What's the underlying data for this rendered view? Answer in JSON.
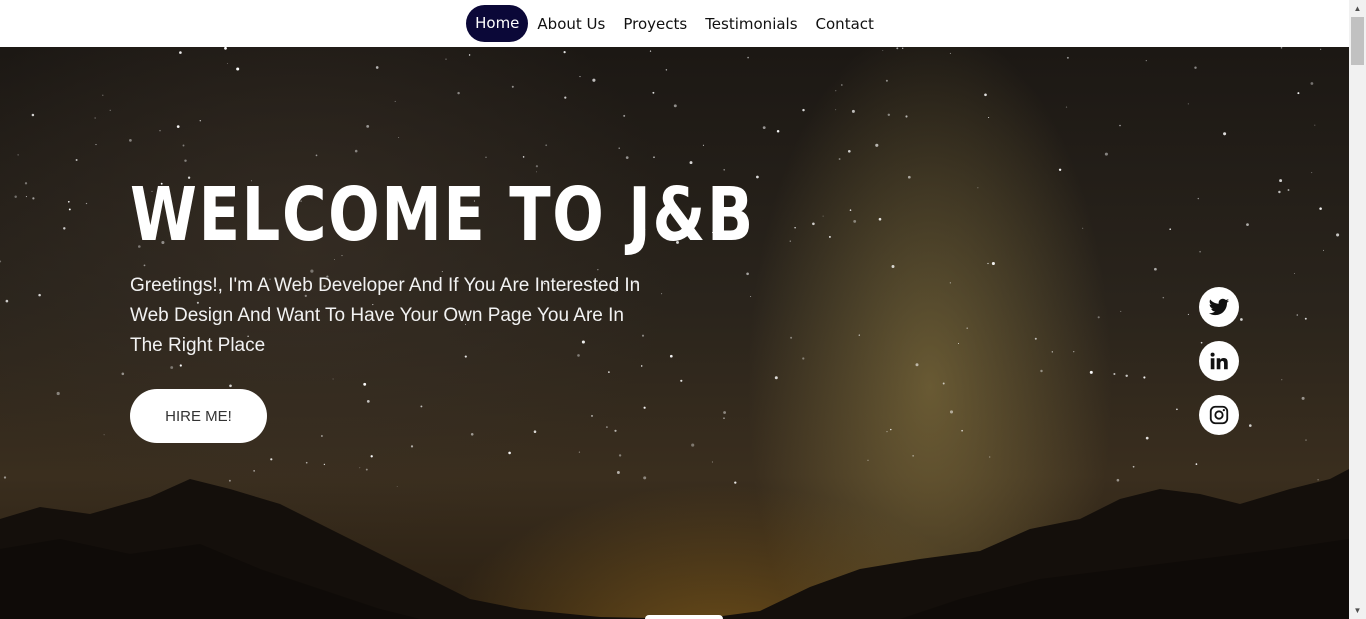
{
  "nav": {
    "items": [
      {
        "label": "Home",
        "active": true
      },
      {
        "label": "About Us",
        "active": false
      },
      {
        "label": "Proyects",
        "active": false
      },
      {
        "label": "Testimonials",
        "active": false
      },
      {
        "label": "Contact",
        "active": false
      }
    ]
  },
  "hero": {
    "title": "WELCOME TO J&B",
    "text": "Greetings!, I'm A Web Developer And If You Are Interested In Web Design And Want To Have Your Own Page You Are In The Right Place",
    "button_label": "HIRE ME!"
  },
  "social": {
    "icons": [
      "twitter-icon",
      "linkedin-icon",
      "instagram-icon"
    ]
  },
  "colors": {
    "nav_active_bg": "#0b0838",
    "nav_active_text": "#ffffff",
    "hero_text": "#ffffff"
  }
}
